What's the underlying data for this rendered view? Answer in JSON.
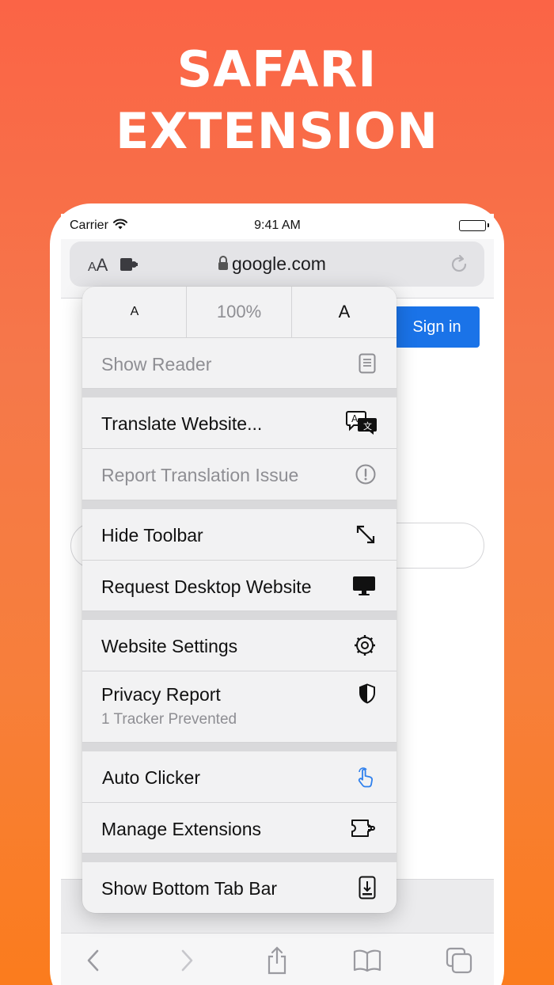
{
  "headline": {
    "line1": "SAFARI",
    "line2": "EXTENSION"
  },
  "status_bar": {
    "carrier": "Carrier",
    "time": "9:41 AM"
  },
  "address_bar": {
    "text_size_label": "AA",
    "url": "google.com"
  },
  "page": {
    "sign_in": "Sign in"
  },
  "menu": {
    "zoom": {
      "decrease": "A",
      "level": "100%",
      "increase": "A"
    },
    "items": [
      {
        "label": "Show Reader",
        "icon": "reader-icon",
        "disabled": true
      },
      {
        "label": "Translate Website...",
        "icon": "translate-icon"
      },
      {
        "label": "Report Translation Issue",
        "icon": "exclamation-circle-icon",
        "disabled": true
      },
      {
        "label": "Hide Toolbar",
        "icon": "expand-arrows-icon"
      },
      {
        "label": "Request Desktop Website",
        "icon": "desktop-icon"
      },
      {
        "label": "Website Settings",
        "icon": "gear-icon"
      },
      {
        "label": "Privacy Report",
        "sublabel": "1 Tracker Prevented",
        "icon": "shield-icon"
      },
      {
        "label": "Auto Clicker",
        "icon": "tap-hand-icon",
        "accent": "#2f80ed"
      },
      {
        "label": "Manage Extensions",
        "icon": "puzzle-icon"
      },
      {
        "label": "Show Bottom Tab Bar",
        "icon": "bottom-bar-icon"
      }
    ]
  },
  "toolbar": {
    "icons": [
      "back-icon",
      "forward-icon",
      "share-icon",
      "bookmarks-icon",
      "tabs-icon"
    ]
  },
  "colors": {
    "accent_blue": "#1a73e8",
    "background_top": "#fb6446",
    "background_bottom": "#fb7c1d"
  }
}
